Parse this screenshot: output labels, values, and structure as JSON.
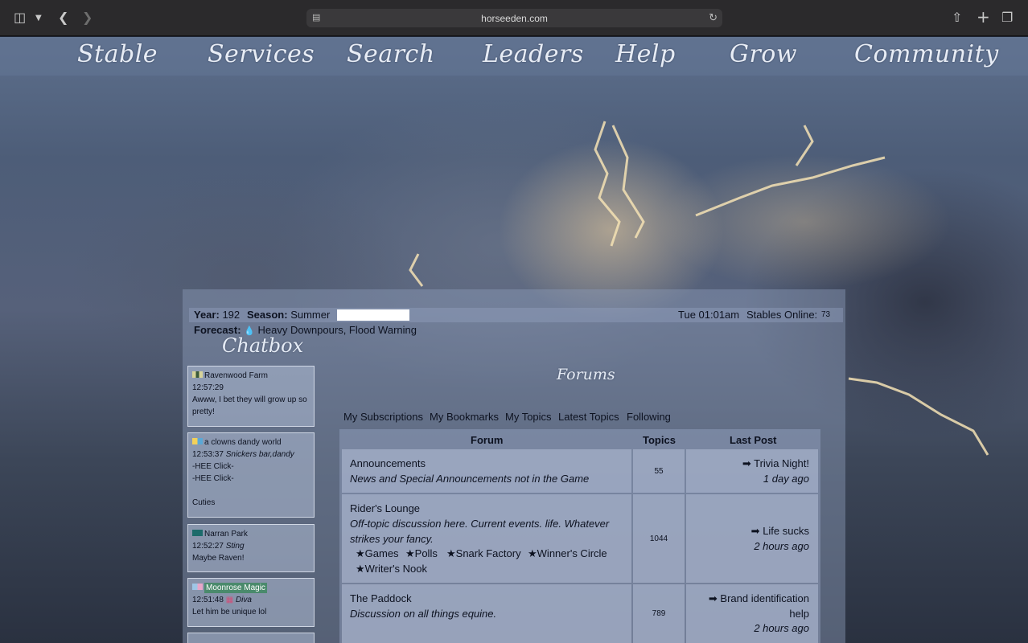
{
  "browser": {
    "url": "horseeden.com"
  },
  "nav": [
    {
      "label": "Stable"
    },
    {
      "label": "Services"
    },
    {
      "label": "Search"
    },
    {
      "label": "Leaders"
    },
    {
      "label": "Help"
    },
    {
      "label": "Grow"
    },
    {
      "label": "Community"
    }
  ],
  "status": {
    "year_label": "Year:",
    "year": "192",
    "season_label": "Season:",
    "season": "Summer",
    "forecast_label": "Forecast:",
    "forecast": "Heavy Downpours, Flood Warning",
    "time": "Tue 01:01am",
    "stables_online_label": "Stables Online:",
    "stables_online": "73"
  },
  "chat": {
    "title": "Chatbox",
    "messages": [
      {
        "user": "Ravenwood Farm",
        "time": "12:57:29",
        "tag": "",
        "lines": [
          "Awww, I bet they will grow up so",
          "pretty!"
        ]
      },
      {
        "user": "a clowns dandy world",
        "time": "12:53:37",
        "tag": "Snickers bar,dandy",
        "lines": [
          "-HEE Click-",
          "-HEE Click-",
          "",
          "Cuties"
        ]
      },
      {
        "user": "Narran Park",
        "time": "12:52:27",
        "tag": "Sting",
        "lines": [
          "Maybe Raven!"
        ]
      },
      {
        "user": "Moonrose Magic",
        "time": "12:51:48",
        "tag": "Diva",
        "lines": [
          "Let him be unique lol"
        ]
      }
    ]
  },
  "forums": {
    "title": "Forums",
    "tabs": [
      "My Subscriptions",
      "My Bookmarks",
      "My Topics",
      "Latest Topics",
      "Following"
    ],
    "headers": {
      "forum": "Forum",
      "topics": "Topics",
      "last_post": "Last Post"
    },
    "rows": [
      {
        "name": "Announcements",
        "desc": "News and Special Announcements not in the Game",
        "topics": "55",
        "last_title": "Trivia Night!",
        "last_ago": "1 day ago"
      },
      {
        "name": "Rider's Lounge",
        "desc_line1": "Off-topic discussion here. Current events. life. Whatever",
        "desc_line2": "strikes your fancy.",
        "subforums": [
          "Games",
          "Polls",
          "Snark Factory",
          "Winner's Circle",
          "Writer's Nook"
        ],
        "topics": "1044",
        "last_title": "Life sucks",
        "last_ago": "2 hours ago"
      },
      {
        "name": "The Paddock",
        "desc": "Discussion on all things equine.",
        "topics": "789",
        "last_title_line1": "Brand identification",
        "last_title_line2": "help",
        "last_ago": "2 hours ago"
      }
    ]
  },
  "colors": {
    "chrome": "#2b2a2c",
    "nav_text": "#e7ecf5",
    "highlight_user": "#4a8a6c"
  }
}
